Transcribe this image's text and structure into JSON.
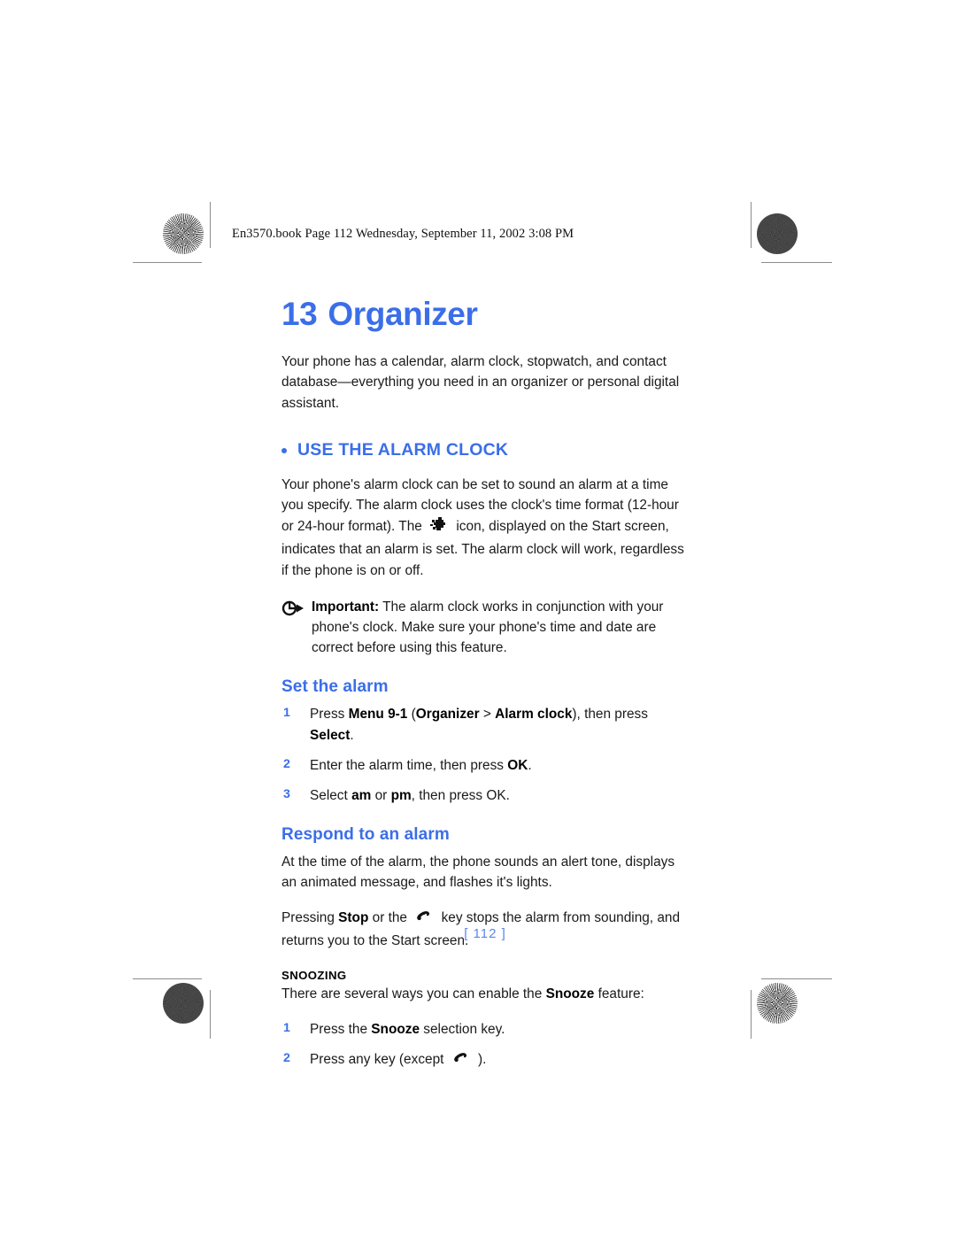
{
  "slug": "En3570.book  Page 112  Wednesday, September 11, 2002  3:08 PM",
  "colors": {
    "heading_blue": "#3b6ee8",
    "page_number_blue": "#5b85ef",
    "body_black": "#1a1a1a"
  },
  "chapter": {
    "number": "13",
    "title": "Organizer",
    "intro": "Your phone has a calendar, alarm clock, stopwatch, and contact database—everything you need in an organizer or personal digital assistant."
  },
  "section": {
    "heading": "USE THE ALARM CLOCK",
    "para_part1": "Your phone's alarm clock can be set to sound an alarm at a time you specify. The alarm clock uses the clock's time format (12-hour or 24-hour format). The",
    "icon_name": "alarm-clock-icon",
    "para_part2": "icon, displayed on the Start screen, indicates that an alarm is set. The alarm clock will work, regardless if the phone is on or off."
  },
  "note": {
    "icon_name": "important-note-icon",
    "label": "Important:",
    "text": " The alarm clock works in conjunction with your phone's clock. Make sure your phone's time and date are correct before using this feature."
  },
  "set_alarm": {
    "heading": "Set the alarm",
    "steps": [
      {
        "n": "1",
        "pre": "Press ",
        "b1": "Menu 9-1",
        "mid1": " (",
        "b2": "Organizer",
        "mid2": " > ",
        "b3": "Alarm clock",
        "mid3": "), then press ",
        "b4": "Select",
        "post": "."
      },
      {
        "n": "2",
        "pre": "Enter the alarm time, then press ",
        "b1": "OK",
        "post": "."
      },
      {
        "n": "3",
        "pre": "Select ",
        "b1": "am",
        "mid1": " or ",
        "b2": "pm",
        "post": ", then press OK."
      }
    ]
  },
  "respond": {
    "heading": "Respond to an alarm",
    "para1": "At the time of the alarm, the phone sounds an alert tone, displays an animated message, and flashes it's lights.",
    "para2_pre": "Pressing ",
    "para2_bold": "Stop",
    "para2_mid": " or the",
    "icon_name": "phone-handset-icon",
    "para2_post": "key stops the alarm from sounding, and returns you to the Start screen."
  },
  "snoozing": {
    "heading": "SNOOZING",
    "intro_pre": "There are several ways you can enable the ",
    "intro_bold": "Snooze",
    "intro_post": " feature:",
    "steps": [
      {
        "n": "1",
        "pre": "Press the ",
        "b1": "Snooze",
        "post": " selection key."
      },
      {
        "n": "2",
        "pre": "Press any key (except",
        "icon_name": "phone-handset-icon",
        "post": ")."
      }
    ]
  },
  "footer": {
    "page_number": "[ 112 ]"
  }
}
